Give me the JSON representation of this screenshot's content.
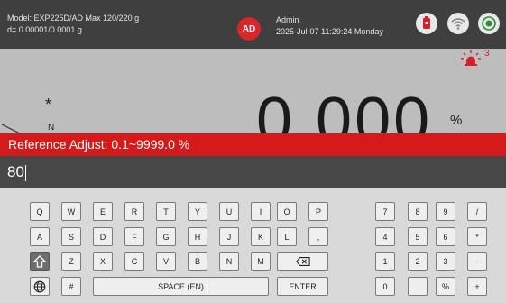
{
  "header": {
    "model_line": "Model: EXP225D/AD   Max 120/220 g",
    "resolution_line": "d= 0.00001/0.0001 g",
    "avatar_initials": "AD",
    "user_name": "Admin",
    "datetime": "2025-Jul-07 11:29:24 Monday",
    "icons": [
      "usb-drive-icon",
      "wifi-icon",
      "level-bubble-icon"
    ]
  },
  "display": {
    "alarm_icon": "alarm-beacon-icon",
    "alarm_count": "3",
    "stability_mark": "*",
    "net_mark": "N",
    "weight": "0.000",
    "unit": "%"
  },
  "prompt": {
    "text": "Reference Adjust: 0.1~9999.0 %"
  },
  "entry": {
    "value": "80"
  },
  "keyboard": {
    "row1": [
      "Q",
      "W",
      "E",
      "R",
      "T",
      "Y",
      "U",
      "I",
      "O",
      "P"
    ],
    "row2": [
      "A",
      "S",
      "D",
      "F",
      "G",
      "H",
      "J",
      "K",
      "L",
      ","
    ],
    "row3": [
      "Z",
      "X",
      "C",
      "V",
      "B",
      "N",
      "M"
    ],
    "hash": "#",
    "space": "SPACE (EN)",
    "enter": "ENTER",
    "numpad": [
      "7",
      "8",
      "9",
      "/",
      "4",
      "5",
      "6",
      "*",
      "1",
      "2",
      "3",
      "-",
      "0",
      ".",
      "%",
      "+"
    ],
    "icons": {
      "shift": "shift-icon",
      "language": "globe-icon",
      "backspace": "backspace-icon"
    }
  }
}
